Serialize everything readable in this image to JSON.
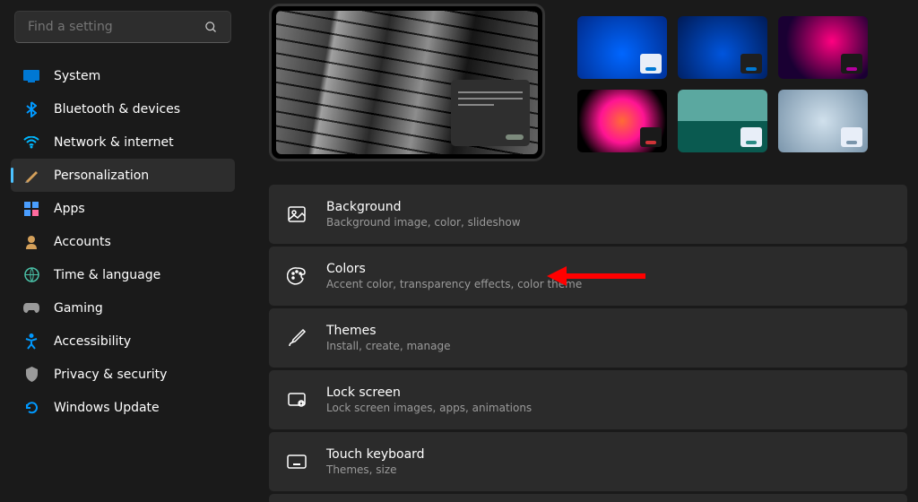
{
  "search": {
    "placeholder": "Find a setting"
  },
  "nav": [
    {
      "label": "System",
      "active": false
    },
    {
      "label": "Bluetooth & devices",
      "active": false
    },
    {
      "label": "Network & internet",
      "active": false
    },
    {
      "label": "Personalization",
      "active": true
    },
    {
      "label": "Apps",
      "active": false
    },
    {
      "label": "Accounts",
      "active": false
    },
    {
      "label": "Time & language",
      "active": false
    },
    {
      "label": "Gaming",
      "active": false
    },
    {
      "label": "Accessibility",
      "active": false
    },
    {
      "label": "Privacy & security",
      "active": false
    },
    {
      "label": "Windows Update",
      "active": false
    }
  ],
  "settings": [
    {
      "title": "Background",
      "sub": "Background image, color, slideshow"
    },
    {
      "title": "Colors",
      "sub": "Accent color, transparency effects, color theme"
    },
    {
      "title": "Themes",
      "sub": "Install, create, manage"
    },
    {
      "title": "Lock screen",
      "sub": "Lock screen images, apps, animations"
    },
    {
      "title": "Touch keyboard",
      "sub": "Themes, size"
    }
  ],
  "annotation": {
    "points_to": "Colors"
  }
}
